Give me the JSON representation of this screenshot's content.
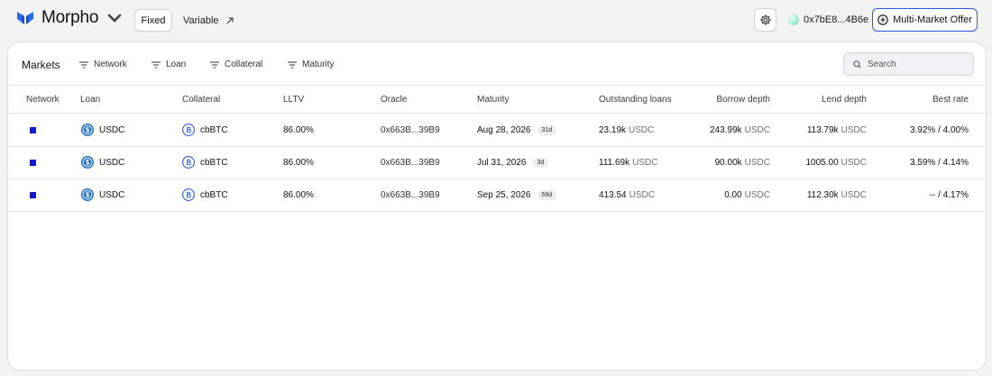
{
  "brand": {
    "name": "Morpho",
    "accent": "#2a6af0"
  },
  "nav": {
    "fixed_label": "Fixed",
    "variable_label": "Variable"
  },
  "wallet": {
    "address": "0x7bE8...4B6e"
  },
  "actions": {
    "multi_market_offer_label": "Multi-Market Offer"
  },
  "markets": {
    "title": "Markets",
    "filters": [
      {
        "label": "Network"
      },
      {
        "label": "Loan"
      },
      {
        "label": "Collateral"
      },
      {
        "label": "Maturity"
      }
    ],
    "search": {
      "placeholder": "Search"
    },
    "columns": [
      "Network",
      "Loan",
      "Collateral",
      "LLTV",
      "Oracle",
      "Maturity",
      "Outstanding loans",
      "Borrow depth",
      "Lend depth",
      "Best rate"
    ],
    "rows": [
      {
        "network_color": "#1515d6",
        "loan": "USDC",
        "collateral": "cbBTC",
        "lltv": "86.00%",
        "oracle": "0x663B...39B9",
        "maturity": "Aug 28, 2026",
        "maturity_badge": "31d",
        "outstanding": "23.19k",
        "outstanding_unit": "USDC",
        "borrow_depth": "243.99k",
        "borrow_unit": "USDC",
        "lend_depth": "113.79k",
        "lend_unit": "USDC",
        "best_rate": "3.92% / 4.00%"
      },
      {
        "network_color": "#1515d6",
        "loan": "USDC",
        "collateral": "cbBTC",
        "lltv": "86.00%",
        "oracle": "0x663B...39B9",
        "maturity": "Jul 31, 2026",
        "maturity_badge": "3d",
        "outstanding": "111.69k",
        "outstanding_unit": "USDC",
        "borrow_depth": "90.00k",
        "borrow_unit": "USDC",
        "lend_depth": "1005.00",
        "lend_unit": "USDC",
        "best_rate": "3.59% / 4.14%"
      },
      {
        "network_color": "#1515d6",
        "loan": "USDC",
        "collateral": "cbBTC",
        "lltv": "86.00%",
        "oracle": "0x663B...39B9",
        "maturity": "Sep 25, 2026",
        "maturity_badge": "59d",
        "outstanding": "413.54",
        "outstanding_unit": "USDC",
        "borrow_depth": "0.00",
        "borrow_unit": "USDC",
        "lend_depth": "112.30k",
        "lend_unit": "USDC",
        "best_rate": "-- / 4.17%"
      }
    ]
  }
}
